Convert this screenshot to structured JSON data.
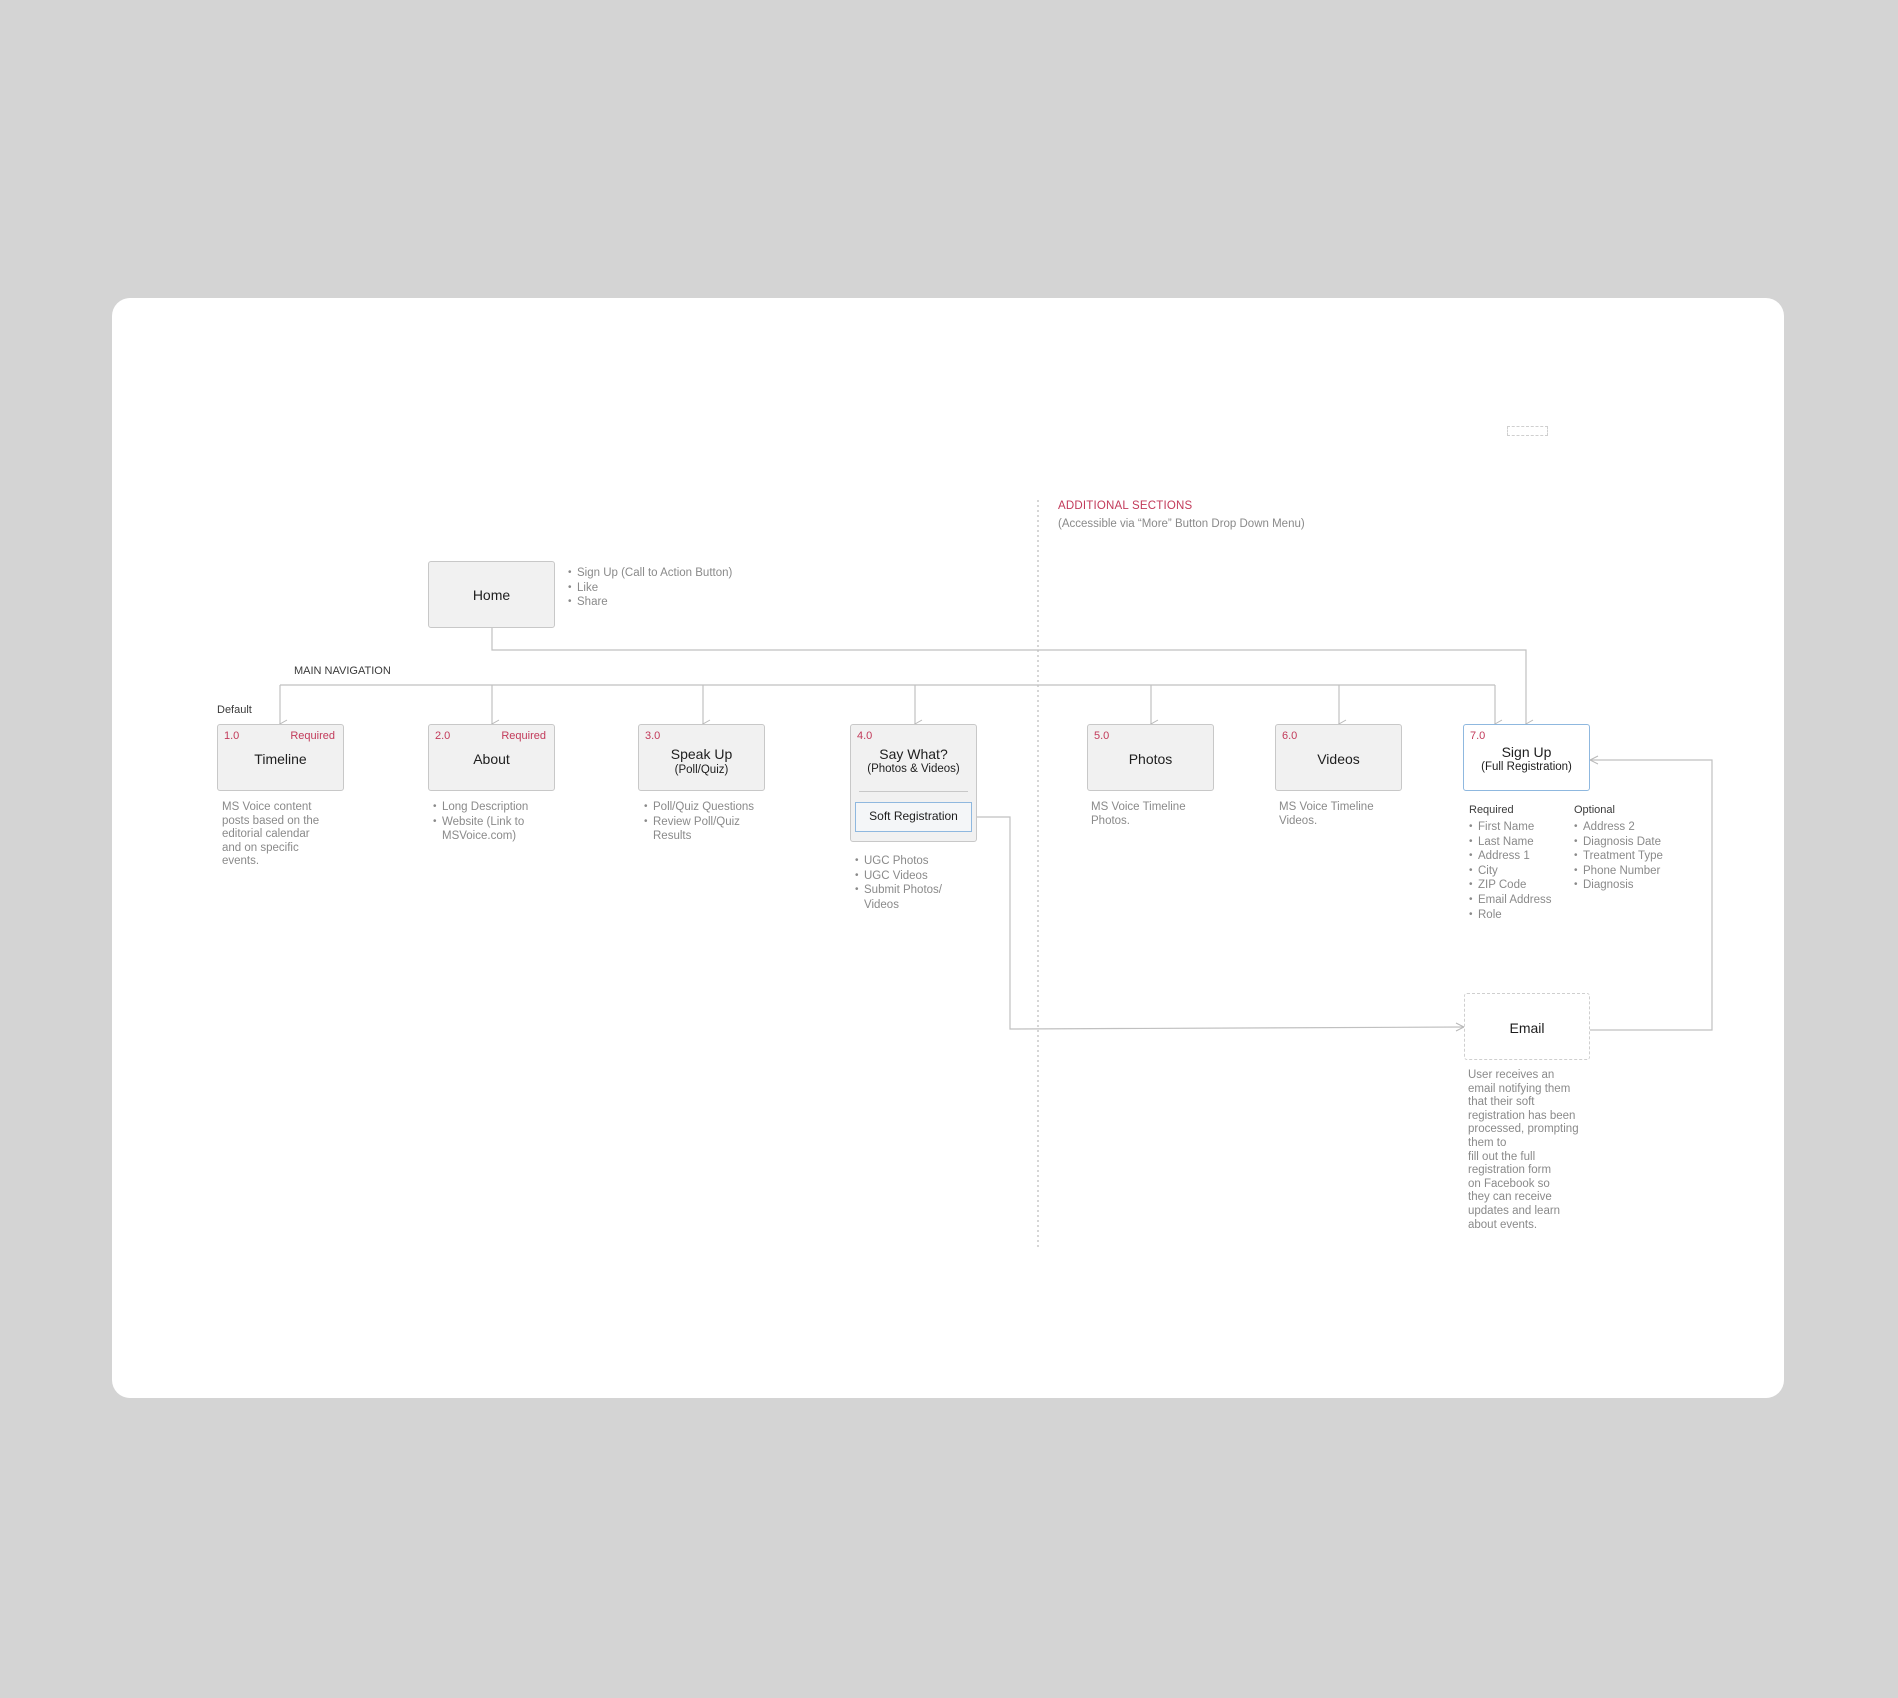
{
  "additional_sections": {
    "title": "ADDITIONAL SECTIONS",
    "subtitle": "(Accessible via “More” Button Drop Down Menu)"
  },
  "home": {
    "title": "Home",
    "bullets": [
      "Sign Up (Call to Action Button)",
      "Like",
      "Share"
    ]
  },
  "main_navigation_label": "MAIN NAVIGATION",
  "default_label": "Default",
  "nodes": [
    {
      "num": "1.0",
      "badge": "Required",
      "title": "Timeline",
      "subtitle": "",
      "note": "MS Voice content\nposts based on the\neditorial calendar\nand on specific\nevents."
    },
    {
      "num": "2.0",
      "badge": "Required",
      "title": "About",
      "subtitle": "",
      "bullets": [
        "Long Description",
        "Website (Link to MSVoice.com)"
      ]
    },
    {
      "num": "3.0",
      "badge": "",
      "title": "Speak Up",
      "subtitle": "(Poll/Quiz)",
      "bullets": [
        "Poll/Quiz Questions",
        "Review Poll/Quiz Results"
      ]
    },
    {
      "num": "4.0",
      "badge": "",
      "title": "Say What?",
      "subtitle": "(Photos & Videos)",
      "inner_button": "Soft Registration",
      "bullets": [
        "UGC Photos",
        "UGC Videos",
        "Submit Photos/ Videos"
      ]
    },
    {
      "num": "5.0",
      "badge": "",
      "title": "Photos",
      "subtitle": "",
      "note": "MS Voice Timeline\nPhotos."
    },
    {
      "num": "6.0",
      "badge": "",
      "title": "Videos",
      "subtitle": "",
      "note": "MS Voice Timeline\nVideos."
    },
    {
      "num": "7.0",
      "badge": "",
      "title": "Sign Up",
      "subtitle": "(Full Registration)",
      "required_label": "Required",
      "required_fields": [
        "First Name",
        "Last Name",
        "Address 1",
        "City",
        "ZIP Code",
        "Email Address",
        "Role"
      ],
      "optional_label": "Optional",
      "optional_fields": [
        "Address 2",
        "Diagnosis Date",
        "Treatment Type",
        "Phone Number",
        "Diagnosis"
      ]
    }
  ],
  "email": {
    "title": "Email",
    "note": "User receives an\nemail notifying them\nthat their soft\nregistration has been\nprocessed, prompting\nthem to\nfill out the full\nregistration form\non Facebook so\nthey can receive\nupdates and learn\nabout events."
  },
  "colors": {
    "accent_red": "#c23a5a",
    "highlight_blue": "#8fb8df",
    "node_fill": "#f1f1f1",
    "line": "#c0c0c0"
  }
}
